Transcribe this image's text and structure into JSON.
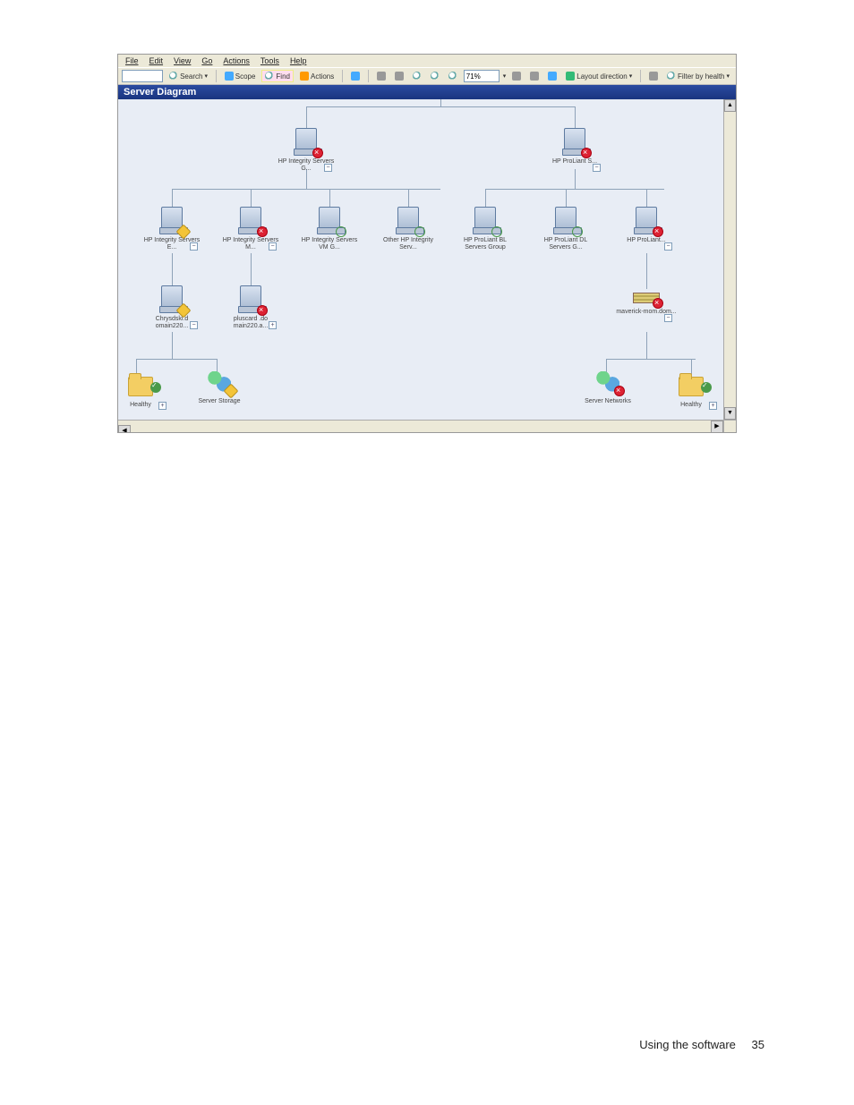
{
  "menu": {
    "file": "File",
    "edit": "Edit",
    "view": "View",
    "go": "Go",
    "actions": "Actions",
    "tools": "Tools",
    "help": "Help"
  },
  "toolbar": {
    "search": "Search",
    "scope": "Scope",
    "find": "Find",
    "actions": "Actions",
    "zoom": "71%",
    "layout": "Layout direction",
    "filter": "Filter by health"
  },
  "title": "Server Diagram",
  "nodes": {
    "r1a": "HP Integrity Servers G...",
    "r1b": "HP ProLiant S...",
    "r2a": "HP Integrity Servers E...",
    "r2b": "HP Integrity Servers M...",
    "r2c": "HP Integrity Servers VM G...",
    "r2d": "Other HP Integrity Serv...",
    "r2e": "HP ProLiant BL Servers Group",
    "r2f": "HP ProLiant DL Servers G...",
    "r2g": "HP ProLiant...",
    "r3a": "Chrysdskl.d omain220...",
    "r3b": "pluscard .do main220.a...",
    "r3c": "maverick-mom.dom...",
    "r4a": "Healthy",
    "r4b": "Server Storage",
    "r4c": "Server Networks",
    "r4d": "Healthy"
  },
  "footer": {
    "section": "Using the software",
    "page": "35"
  }
}
